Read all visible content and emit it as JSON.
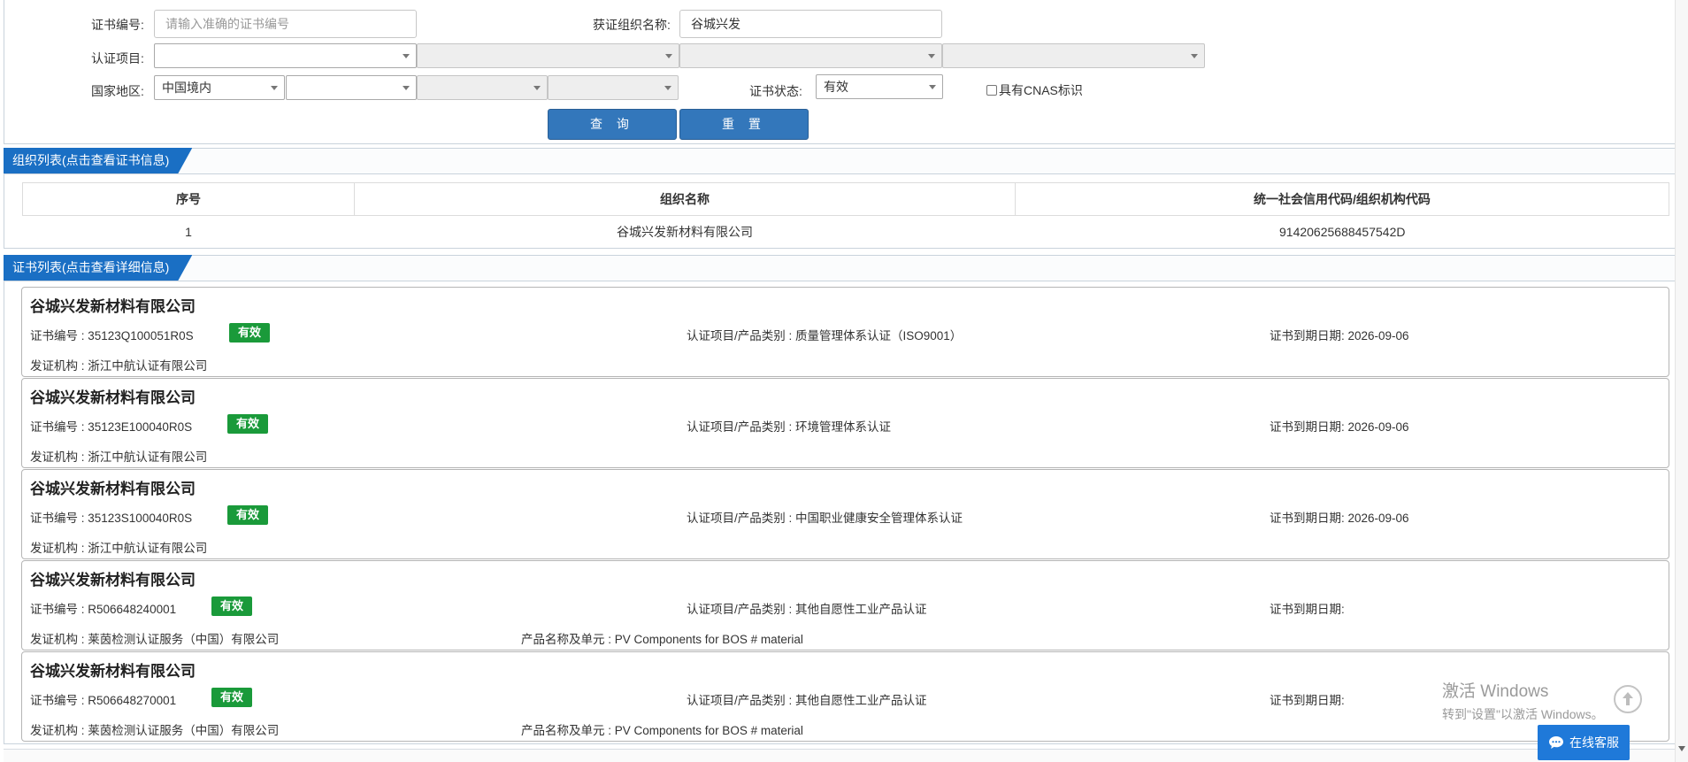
{
  "search": {
    "cert_no_label": "证书编号:",
    "cert_no_placeholder": "请输入准确的证书编号",
    "org_name_label": "获证组织名称:",
    "org_name_value": "谷城兴发",
    "cert_project_label": "认证项目:",
    "cert_project_selects": [
      "",
      "",
      "",
      ""
    ],
    "region_label": "国家地区:",
    "region_selects": [
      "中国境内",
      "",
      "",
      ""
    ],
    "status_label": "证书状态:",
    "status_value": "有效",
    "cnas_label": "具有CNAS标识",
    "query_button": "查 询",
    "reset_button": "重 置"
  },
  "org_list": {
    "title": "组织列表(点击查看证书信息)",
    "headers": [
      "序号",
      "组织名称",
      "统一社会信用代码/组织机构代码"
    ],
    "rows": [
      {
        "index": "1",
        "name": "谷城兴发新材料有限公司",
        "code": "91420625688457542D"
      }
    ]
  },
  "cert_list": {
    "title": "证书列表(点击查看详细信息)",
    "items": [
      {
        "org": "谷城兴发新材料有限公司",
        "cert_no": "证书编号 : 35123Q100051R0S",
        "status": "有效",
        "project": "认证项目/产品类别 : 质量管理体系认证（ISO9001）",
        "expiry": "证书到期日期: 2026-09-06",
        "issuer": "发证机构 : 浙江中航认证有限公司",
        "product": ""
      },
      {
        "org": "谷城兴发新材料有限公司",
        "cert_no": "证书编号 : 35123E100040R0S",
        "status": "有效",
        "project": "认证项目/产品类别 : 环境管理体系认证",
        "expiry": "证书到期日期: 2026-09-06",
        "issuer": "发证机构 : 浙江中航认证有限公司",
        "product": ""
      },
      {
        "org": "谷城兴发新材料有限公司",
        "cert_no": "证书编号 : 35123S100040R0S",
        "status": "有效",
        "project": "认证项目/产品类别 : 中国职业健康安全管理体系认证",
        "expiry": "证书到期日期: 2026-09-06",
        "issuer": "发证机构 : 浙江中航认证有限公司",
        "product": ""
      },
      {
        "org": "谷城兴发新材料有限公司",
        "cert_no": "证书编号 : R506648240001",
        "status": "有效",
        "project": "认证项目/产品类别 : 其他自愿性工业产品认证",
        "expiry": "证书到期日期:",
        "issuer": "发证机构 : 莱茵检测认证服务（中国）有限公司",
        "product": "产品名称及单元 : PV Components for BOS # material"
      },
      {
        "org": "谷城兴发新材料有限公司",
        "cert_no": "证书编号 : R506648270001",
        "status": "有效",
        "project": "认证项目/产品类别 : 其他自愿性工业产品认证",
        "expiry": "证书到期日期:",
        "issuer": "发证机构 : 莱茵检测认证服务（中国）有限公司",
        "product": "产品名称及单元 : PV Components for BOS # material"
      }
    ]
  },
  "watermark": {
    "line1": "激活 Windows",
    "line2": "转到\"设置\"以激活 Windows。"
  },
  "chat": {
    "label": "在线客服"
  },
  "icons": {
    "back_top": "arrow-up-circle-icon",
    "chat": "chat-bubble-icon",
    "caret": "chevron-down-icon"
  },
  "colors": {
    "primary_button": "#3377bb",
    "panel_title": "#1a6fc4",
    "badge_valid": "#1a9a3a",
    "chat_button": "#1f79d9"
  }
}
